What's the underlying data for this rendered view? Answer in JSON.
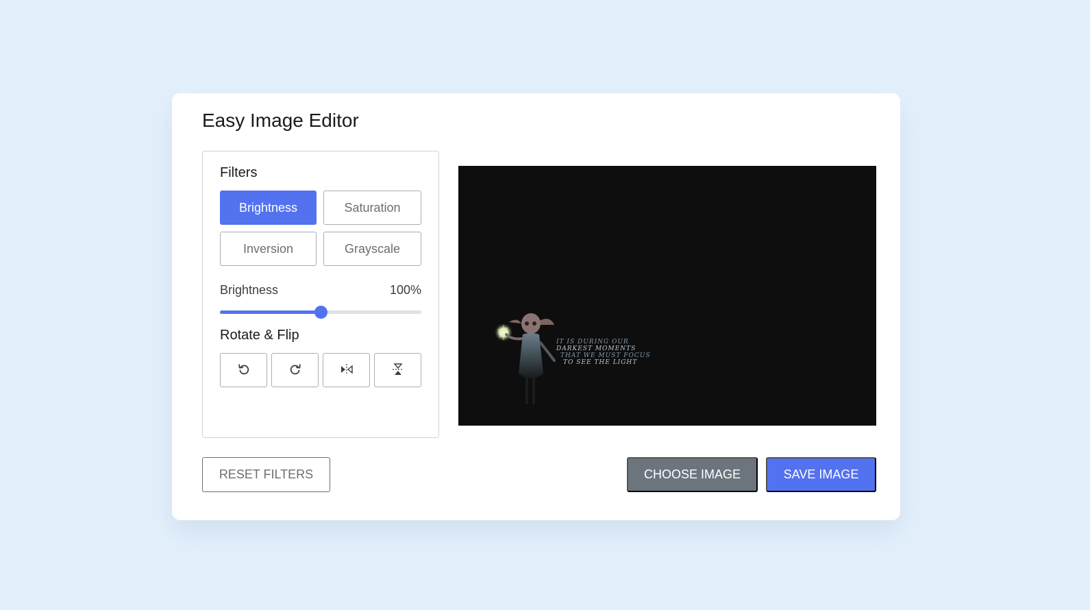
{
  "app": {
    "title": "Easy Image Editor"
  },
  "filters": {
    "label": "Filters",
    "options": [
      {
        "label": "Brightness",
        "active": true
      },
      {
        "label": "Saturation",
        "active": false
      },
      {
        "label": "Inversion",
        "active": false
      },
      {
        "label": "Grayscale",
        "active": false
      }
    ]
  },
  "slider": {
    "name": "Brightness",
    "value_text": "100%",
    "value": 100,
    "max": 200,
    "color": "#5372f0"
  },
  "rotate": {
    "label": "Rotate & Flip",
    "buttons": [
      {
        "icon": "rotate-left-icon"
      },
      {
        "icon": "rotate-right-icon"
      },
      {
        "icon": "flip-horizontal-icon"
      },
      {
        "icon": "flip-vertical-icon"
      }
    ]
  },
  "preview": {
    "quote_lines": [
      "It is during our",
      "darkest moments",
      "that we must focus",
      "to see the light"
    ]
  },
  "actions": {
    "reset_label": "RESET FILTERS",
    "choose_label": "CHOOSE IMAGE",
    "save_label": "SAVE IMAGE"
  },
  "colors": {
    "accent": "#5372f0",
    "secondary": "#6c757d",
    "background": "#e3f0fc"
  }
}
